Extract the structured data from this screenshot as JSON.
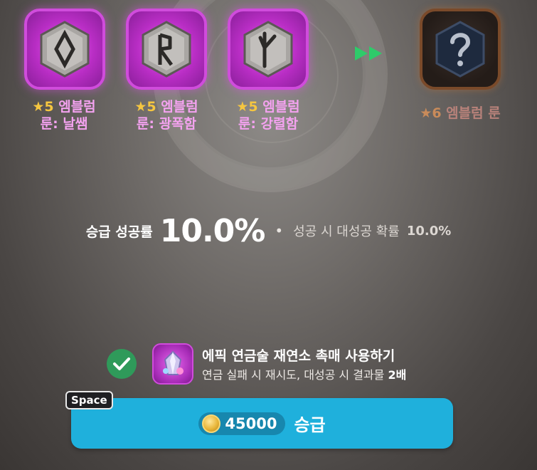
{
  "materials": [
    {
      "star": "★5",
      "name_line1": "엠블럼",
      "name_line2": "룬: 날쌤",
      "rune": "diamond-rune"
    },
    {
      "star": "★5",
      "name_line1": "엠블럼",
      "name_line2": "룬: 광폭함",
      "rune": "r-rune"
    },
    {
      "star": "★5",
      "name_line1": "엠블럼",
      "name_line2": "룬: 강렬함",
      "rune": "y-rune"
    }
  ],
  "result": {
    "star": "★6",
    "name": "엠블럼 룬",
    "icon": "question-mark-icon"
  },
  "rate": {
    "label": "승급 성공률",
    "value": "10.0%",
    "great_label": "성공 시 대성공 확률",
    "great_value": "10.0%"
  },
  "option": {
    "checked": true,
    "title": "에픽 연금술 재연소 촉매 사용하기",
    "desc_prefix": "연금 실패 시 재시도, 대성공 시 결과물",
    "desc_bold": "2배"
  },
  "hotkey": "Space",
  "upgrade": {
    "cost": "45000",
    "label": "승급"
  },
  "colors": {
    "epic": "#d04cdc",
    "button": "#1fb0dc",
    "check": "#2f9a5a",
    "arrow": "#2ecb6a"
  }
}
